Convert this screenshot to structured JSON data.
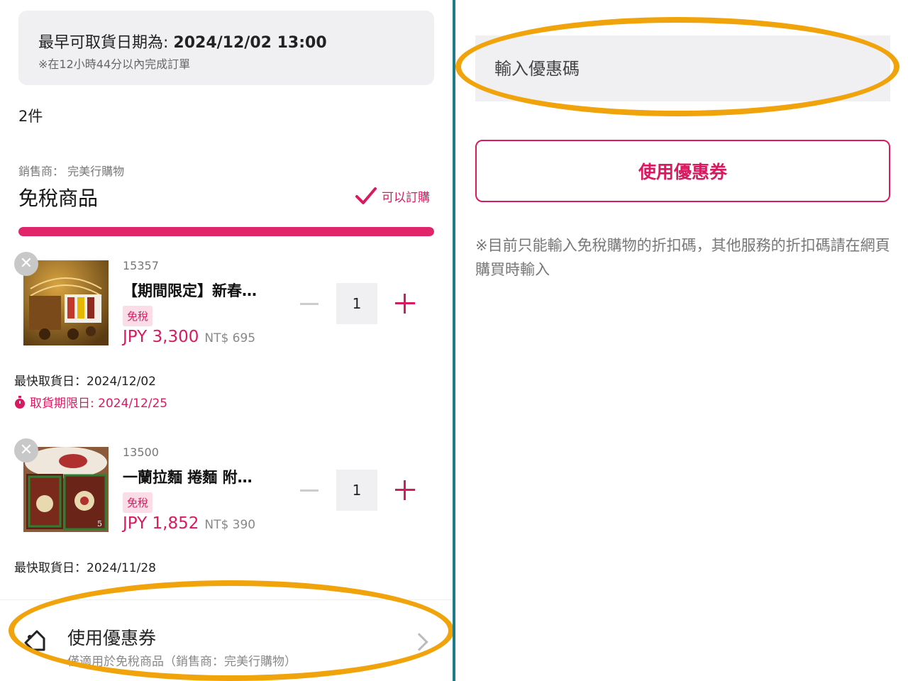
{
  "pickup": {
    "title_prefix": "最早可取貨日期為: ",
    "datetime": "2024/12/02 13:00",
    "note": "※在12小時44分以內完成訂單"
  },
  "cart": {
    "item_count": "2件",
    "seller": "銷售商： 完美行購物",
    "section_title": "免稅商品",
    "status": "可以訂購",
    "progress": 1.0
  },
  "products": [
    {
      "sku": "15357",
      "name": "【期間限定】新春…",
      "tag": "免稅",
      "price": "JPY 3,300",
      "price_twd": "NT$ 695",
      "qty": "1",
      "earliest": "最快取貨日：2024/12/02",
      "deadline": "取貨期限日: 2024/12/25"
    },
    {
      "sku": "13500",
      "name": "一蘭拉麵 捲麵 附…",
      "tag": "免稅",
      "price": "JPY 1,852",
      "price_twd": "NT$ 390",
      "qty": "1",
      "earliest": "最快取貨日：2024/11/28"
    }
  ],
  "coupon_bar": {
    "title": "使用優惠券",
    "subtitle": "僅適用於免稅商品（銷售商：完美行購物）",
    "icon": "tag-icon"
  },
  "coupon_panel": {
    "input_placeholder": "輸入優惠碼",
    "apply_label": "使用優惠券",
    "note": "※目前只能輸入免稅購物的折扣碼，其他服務的折扣碼請在網頁購買時輸入"
  },
  "colors": {
    "accent": "#d81b60",
    "highlight": "#f0a30a",
    "divider": "#1f7a8c"
  }
}
